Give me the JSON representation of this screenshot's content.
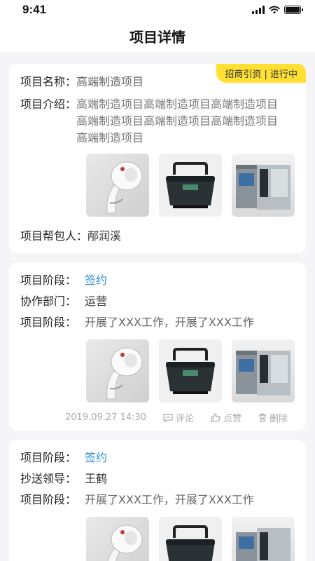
{
  "status_bar": {
    "time": "9:41"
  },
  "nav": {
    "title": "项目详情"
  },
  "project": {
    "badge": "招商引资 | 进行中",
    "name_label": "项目名称：",
    "name_value": "高端制造项目",
    "intro_label": "项目介绍：",
    "intro_value": "高端制造项目高端制造项目高端制造项目高端制造项目高端制造项目高端制造项目高端制造项目",
    "helper_label": "项目帮包人：",
    "helper_value": "邴润溪",
    "images": [
      "hair-dryer-image",
      "portable-generator-image",
      "industrial-machine-image"
    ]
  },
  "records": [
    {
      "stage_label": "项目阶段：",
      "stage_value": "签约",
      "dept_label": "协作部门：",
      "dept_value": "运营",
      "progress_label": "项目阶段：",
      "progress_value": "开展了XXX工作，开展了XXX工作",
      "timestamp": "2019.09.27 14:30",
      "comment_label": "评论",
      "like_label": "点赞",
      "delete_label": "删除"
    },
    {
      "stage_label": "项目阶段：",
      "stage_value": "签约",
      "dept_label": "抄送领导：",
      "dept_value": "王鹤",
      "progress_label": "项目阶段：",
      "progress_value": "开展了XXX工作，开展了XXX工作"
    }
  ],
  "colors": {
    "accent_blue": "#2f8fd8",
    "badge_yellow": "#ffe033",
    "background": "#f5f5f7"
  }
}
